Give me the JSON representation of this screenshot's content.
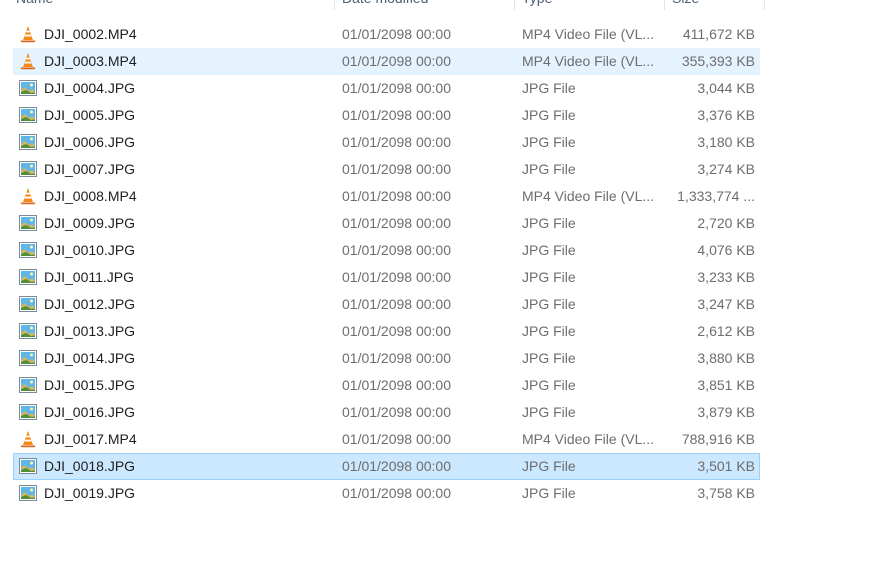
{
  "columns": {
    "name": "Name",
    "date": "Date modified",
    "type": "Type",
    "size": "Size"
  },
  "colors": {
    "hover": "#e5f3ff",
    "selected": "#cce8ff",
    "selected_border": "#99d1ff"
  },
  "files": [
    {
      "name": "DJI_0002.MP4",
      "date": "01/01/2098 00:00",
      "type": "MP4 Video File (VL...",
      "size": "411,672 KB",
      "icon": "vlc-cone-icon",
      "state": ""
    },
    {
      "name": "DJI_0003.MP4",
      "date": "01/01/2098 00:00",
      "type": "MP4 Video File (VL...",
      "size": "355,393 KB",
      "icon": "vlc-cone-icon",
      "state": "hover"
    },
    {
      "name": "DJI_0004.JPG",
      "date": "01/01/2098 00:00",
      "type": "JPG File",
      "size": "3,044 KB",
      "icon": "image-file-icon",
      "state": ""
    },
    {
      "name": "DJI_0005.JPG",
      "date": "01/01/2098 00:00",
      "type": "JPG File",
      "size": "3,376 KB",
      "icon": "image-file-icon",
      "state": ""
    },
    {
      "name": "DJI_0006.JPG",
      "date": "01/01/2098 00:00",
      "type": "JPG File",
      "size": "3,180 KB",
      "icon": "image-file-icon",
      "state": ""
    },
    {
      "name": "DJI_0007.JPG",
      "date": "01/01/2098 00:00",
      "type": "JPG File",
      "size": "3,274 KB",
      "icon": "image-file-icon",
      "state": ""
    },
    {
      "name": "DJI_0008.MP4",
      "date": "01/01/2098 00:00",
      "type": "MP4 Video File (VL...",
      "size": "1,333,774 ...",
      "icon": "vlc-cone-icon",
      "state": ""
    },
    {
      "name": "DJI_0009.JPG",
      "date": "01/01/2098 00:00",
      "type": "JPG File",
      "size": "2,720 KB",
      "icon": "image-file-icon",
      "state": ""
    },
    {
      "name": "DJI_0010.JPG",
      "date": "01/01/2098 00:00",
      "type": "JPG File",
      "size": "4,076 KB",
      "icon": "image-file-icon",
      "state": ""
    },
    {
      "name": "DJI_0011.JPG",
      "date": "01/01/2098 00:00",
      "type": "JPG File",
      "size": "3,233 KB",
      "icon": "image-file-icon",
      "state": ""
    },
    {
      "name": "DJI_0012.JPG",
      "date": "01/01/2098 00:00",
      "type": "JPG File",
      "size": "3,247 KB",
      "icon": "image-file-icon",
      "state": ""
    },
    {
      "name": "DJI_0013.JPG",
      "date": "01/01/2098 00:00",
      "type": "JPG File",
      "size": "2,612 KB",
      "icon": "image-file-icon",
      "state": ""
    },
    {
      "name": "DJI_0014.JPG",
      "date": "01/01/2098 00:00",
      "type": "JPG File",
      "size": "3,880 KB",
      "icon": "image-file-icon",
      "state": ""
    },
    {
      "name": "DJI_0015.JPG",
      "date": "01/01/2098 00:00",
      "type": "JPG File",
      "size": "3,851 KB",
      "icon": "image-file-icon",
      "state": ""
    },
    {
      "name": "DJI_0016.JPG",
      "date": "01/01/2098 00:00",
      "type": "JPG File",
      "size": "3,879 KB",
      "icon": "image-file-icon",
      "state": ""
    },
    {
      "name": "DJI_0017.MP4",
      "date": "01/01/2098 00:00",
      "type": "MP4 Video File (VL...",
      "size": "788,916 KB",
      "icon": "vlc-cone-icon",
      "state": ""
    },
    {
      "name": "DJI_0018.JPG",
      "date": "01/01/2098 00:00",
      "type": "JPG File",
      "size": "3,501 KB",
      "icon": "image-file-icon",
      "state": "selected"
    },
    {
      "name": "DJI_0019.JPG",
      "date": "01/01/2098 00:00",
      "type": "JPG File",
      "size": "3,758 KB",
      "icon": "image-file-icon",
      "state": ""
    }
  ]
}
